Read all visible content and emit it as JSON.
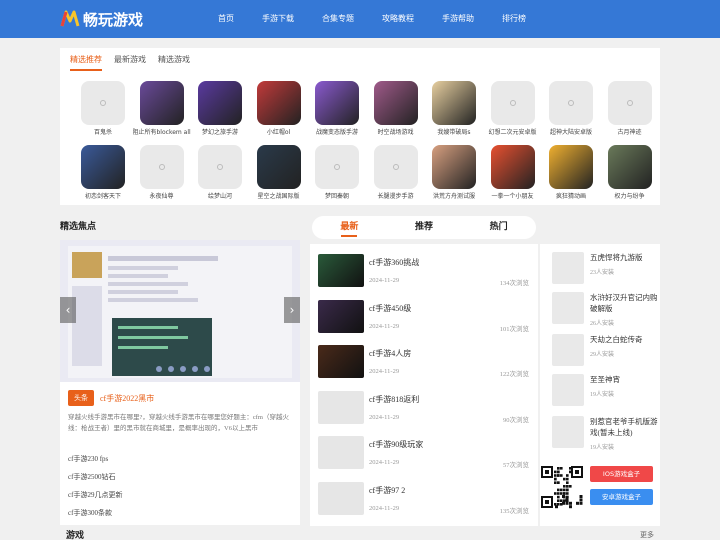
{
  "header": {
    "logo_text": "畅玩游戏",
    "nav": [
      "首页",
      "手游下载",
      "合集专题",
      "攻略教程",
      "手游帮助",
      "排行榜"
    ]
  },
  "top_tabs": [
    "精选推荐",
    "最新游戏",
    "精选游戏"
  ],
  "games_row1": [
    "百鬼杀",
    "阻止所有blockem all",
    "梦幻之旅手游",
    "小红帽ol",
    "战魔变态版手游",
    "时空战场游戏",
    "我嫂带破局s",
    "幻想二次元安卓版",
    "超神大陆安卓版",
    "古月神迹"
  ],
  "games_row2": [
    "初恋剑客天下",
    "永夜仙尊",
    "绘梦山河",
    "星空之战国际版",
    "梦回秦朝",
    "长腿漫步手游",
    "洪荒方舟测试服",
    "一拳一个小朋友",
    "疯狂猜动画",
    "权力与纷争"
  ],
  "focus": {
    "title": "精选焦点",
    "badge": "头条",
    "headline": "cf手游2022黑市",
    "desc": "穿越火线手游黑市在哪里?，穿越火线手游黑市在哪里您好题主：cfm（穿越火线：枪战王者）里的黑市就在商城里，是概率出现的，V6以上黑市",
    "links": [
      "cf手游230 fps",
      "cf手游2500钻石",
      "cf手游29几点更新",
      "cf手游300条款"
    ]
  },
  "mid_tabs": [
    "最新",
    "推荐",
    "热门"
  ],
  "news": [
    {
      "title": "cf手游360挑战",
      "date": "2024-11-29",
      "views": "134次浏览"
    },
    {
      "title": "cf手游450级",
      "date": "2024-11-29",
      "views": "101次浏览"
    },
    {
      "title": "cf手游4人房",
      "date": "2024-11-29",
      "views": "122次浏览"
    },
    {
      "title": "cf手游818返利",
      "date": "2024-11-29",
      "views": "90次浏览"
    },
    {
      "title": "cf手游90级玩家",
      "date": "2024-11-29",
      "views": "57次浏览"
    },
    {
      "title": "cf手游97 2",
      "date": "2024-11-29",
      "views": "135次浏览"
    }
  ],
  "right_list": [
    {
      "title": "五虎悍将九游版",
      "sub": "23人安装"
    },
    {
      "title": "水浒好汉升官记内购破解版",
      "sub": "26人安装"
    },
    {
      "title": "天劫之白蛇传奇",
      "sub": "29人安装"
    },
    {
      "title": "至圣神宵",
      "sub": "19人安装"
    },
    {
      "title": "别惹官老爷手机版游戏(暂未上线)",
      "sub": "19人安装"
    }
  ],
  "download": {
    "ios": "IOS游戏盒子",
    "android": "安卓游戏盒子"
  },
  "bottom": {
    "left": "游戏",
    "right": "更多"
  },
  "colors": {
    "brand": "#3578d6",
    "accent": "#e8601a",
    "ios_btn": "#f04848",
    "android_btn": "#3a8ef0"
  }
}
